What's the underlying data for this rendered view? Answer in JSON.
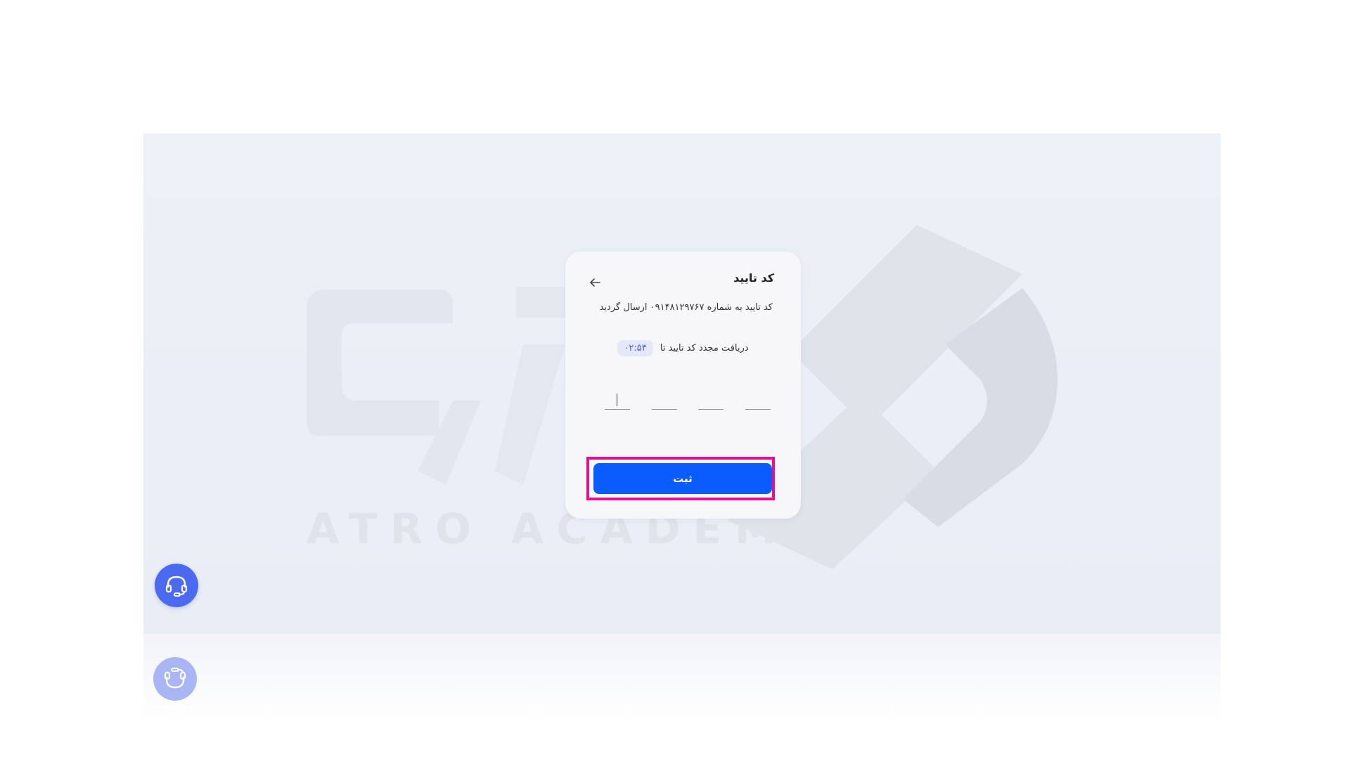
{
  "watermark": {
    "text": "ATRO ACADEMY"
  },
  "dialog": {
    "title": "کد تایید",
    "sent_message": "کد تایید به شماره ۰۹۱۴۸۱۲۹۷۶۷ ارسال گردید",
    "resend_label": "دریافت مجدد کد تایید تا",
    "timer": "۰۲:۵۴",
    "submit_label": "ثبت",
    "otp_digits": [
      "",
      "",
      "",
      ""
    ]
  },
  "colors": {
    "primary": "#0a5cff",
    "highlight": "#e6118c",
    "timer_text": "#4a5fd8",
    "fab": "#4c6af0"
  },
  "icons": {
    "back": "arrow-left-icon",
    "support": "headset-icon"
  }
}
